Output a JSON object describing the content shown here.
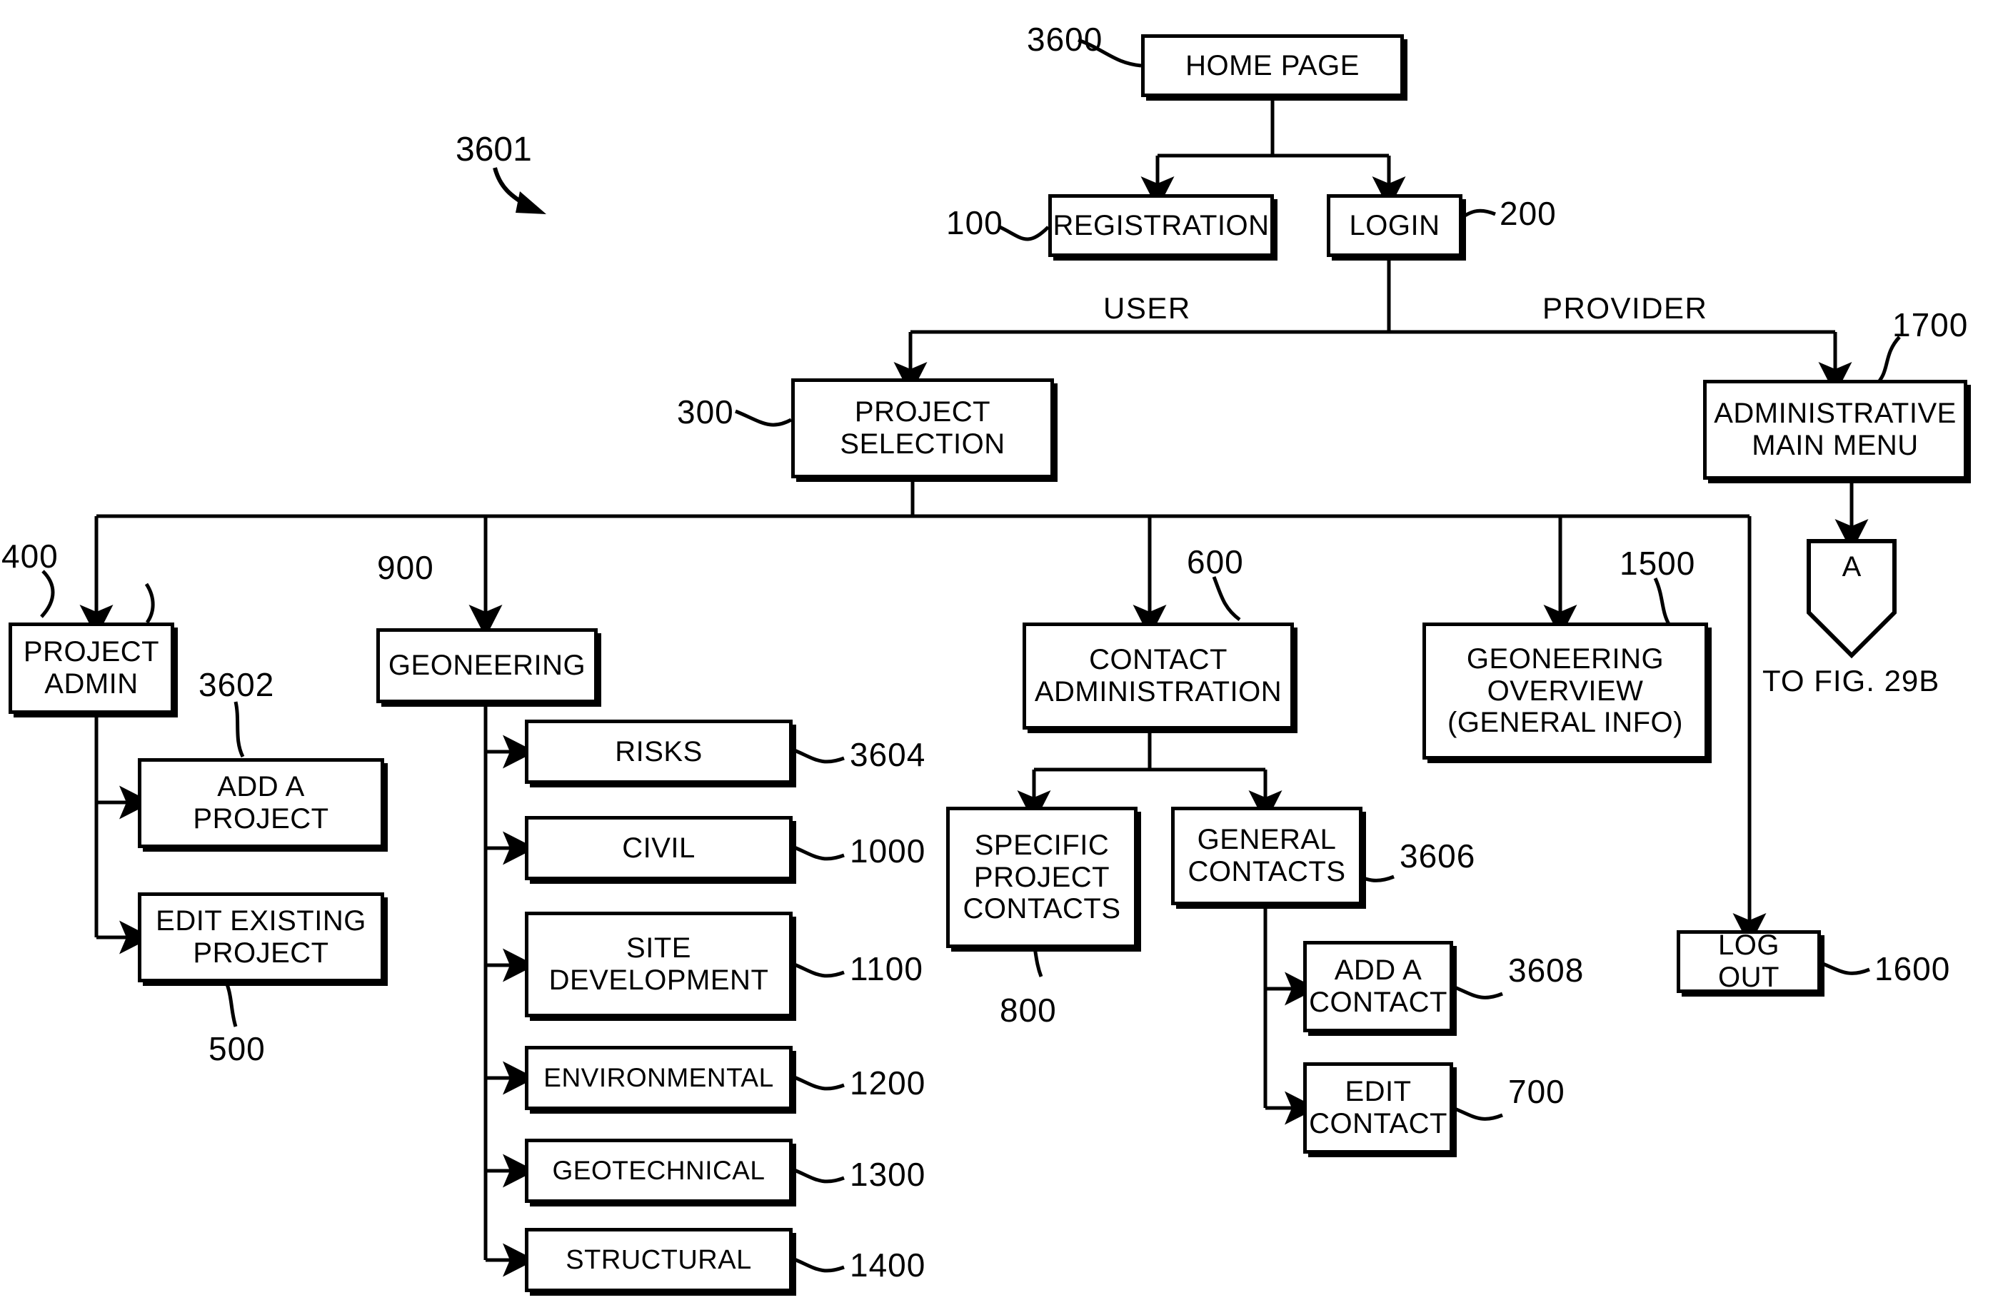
{
  "figure": {
    "ref": "3601",
    "offpage_connector_label": "A",
    "offpage_destination": "TO FIG. 29B"
  },
  "edge_labels": {
    "user": "USER",
    "provider": "PROVIDER"
  },
  "nodes": [
    {
      "id": "home_page",
      "label": "HOME PAGE",
      "ref": "3600"
    },
    {
      "id": "registration",
      "label": "REGISTRATION",
      "ref": "100"
    },
    {
      "id": "login",
      "label": "LOGIN",
      "ref": "200"
    },
    {
      "id": "project_selection",
      "label": "PROJECT\nSELECTION",
      "ref": "300"
    },
    {
      "id": "admin_main_menu",
      "label": "ADMINISTRATIVE\nMAIN MENU",
      "ref": "1700"
    },
    {
      "id": "project_admin",
      "label": "PROJECT\nADMIN",
      "ref": "400"
    },
    {
      "id": "add_a_project",
      "label": "ADD A\nPROJECT",
      "ref": "3602"
    },
    {
      "id": "edit_existing",
      "label": "EDIT EXISTING\nPROJECT",
      "ref": "500"
    },
    {
      "id": "geoneering",
      "label": "GEONEERING",
      "ref": "900"
    },
    {
      "id": "risks",
      "label": "RISKS",
      "ref": "3604"
    },
    {
      "id": "civil",
      "label": "CIVIL",
      "ref": "1000"
    },
    {
      "id": "site_development",
      "label": "SITE\nDEVELOPMENT",
      "ref": "1100"
    },
    {
      "id": "environmental",
      "label": "ENVIRONMENTAL",
      "ref": "1200"
    },
    {
      "id": "geotechnical",
      "label": "GEOTECHNICAL",
      "ref": "1300"
    },
    {
      "id": "structural",
      "label": "STRUCTURAL",
      "ref": "1400"
    },
    {
      "id": "contact_admin",
      "label": "CONTACT\nADMINISTRATION",
      "ref": "600"
    },
    {
      "id": "specific_contacts",
      "label": "SPECIFIC\nPROJECT\nCONTACTS",
      "ref": "800"
    },
    {
      "id": "general_contacts",
      "label": "GENERAL\nCONTACTS",
      "ref": "3606"
    },
    {
      "id": "add_a_contact",
      "label": "ADD A\nCONTACT",
      "ref": "3608"
    },
    {
      "id": "edit_contact",
      "label": "EDIT\nCONTACT",
      "ref": "700"
    },
    {
      "id": "geoneering_overview",
      "label": "GEONEERING\nOVERVIEW\n(GENERAL INFO)",
      "ref": "1500"
    },
    {
      "id": "log_out",
      "label": "LOG OUT",
      "ref": "1600"
    }
  ],
  "colors": {
    "ink": "#000000",
    "paper": "#ffffff"
  }
}
